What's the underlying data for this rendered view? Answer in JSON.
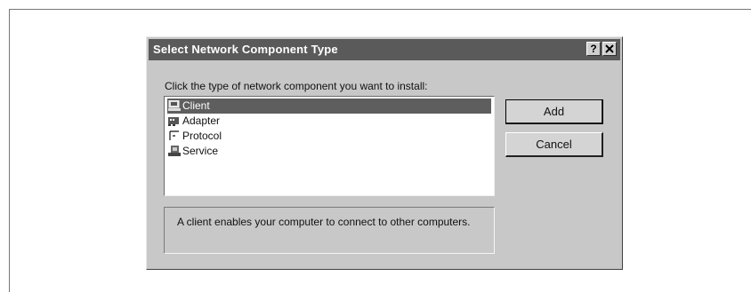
{
  "dialog": {
    "title": "Select Network Component Type",
    "help_label": "?",
    "close_label": "✕",
    "instruction": "Click the type of network component you want to install:",
    "components": [
      {
        "label": "Client",
        "icon": "client-icon",
        "selected": true
      },
      {
        "label": "Adapter",
        "icon": "adapter-icon",
        "selected": false
      },
      {
        "label": "Protocol",
        "icon": "protocol-icon",
        "selected": false
      },
      {
        "label": "Service",
        "icon": "service-icon",
        "selected": false
      }
    ],
    "add_label": "Add",
    "cancel_label": "Cancel",
    "description": "A client enables your computer to connect to other computers."
  },
  "colors": {
    "title_bar": "#5a5a5a",
    "dialog_face": "#c8c8c8",
    "selection": "#5e5e5e"
  }
}
